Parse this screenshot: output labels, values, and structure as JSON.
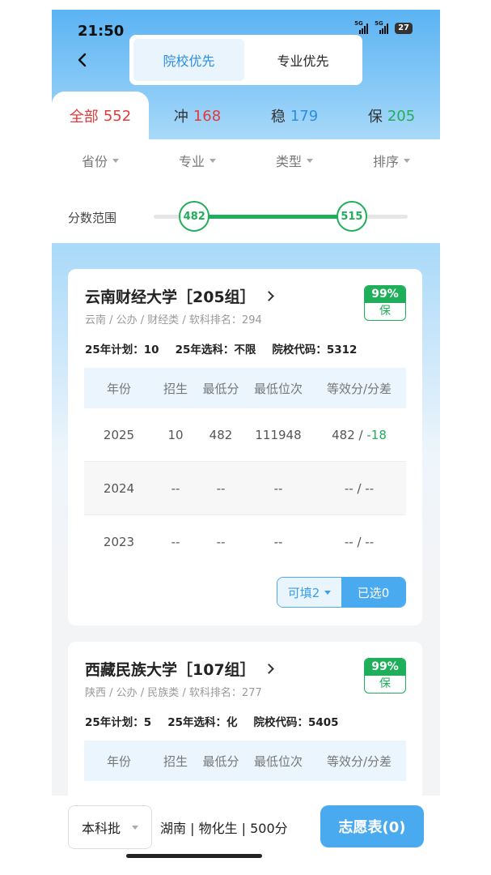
{
  "status": {
    "time": "21:50",
    "net1": "5G",
    "net2": "5G",
    "battery": "27"
  },
  "segment": {
    "options": [
      "院校优先",
      "专业优先"
    ],
    "active": 0
  },
  "tabs": [
    {
      "label": "全部",
      "count": "552",
      "color": "#e03a3a"
    },
    {
      "label": "冲",
      "count": "168",
      "color": "#e03a3a"
    },
    {
      "label": "稳",
      "count": "179",
      "color": "#2b8de3"
    },
    {
      "label": "保",
      "count": "205",
      "color": "#1fae5a"
    }
  ],
  "filters": [
    "省份",
    "专业",
    "类型",
    "排序"
  ],
  "score_range": {
    "label": "分数范围",
    "min": "482",
    "max": "515",
    "low_fraction": 0.16,
    "high_fraction": 0.78
  },
  "table_headers": [
    "年份",
    "招生",
    "最低分",
    "最低位次",
    "等效分/分差"
  ],
  "cards": [
    {
      "name": "云南财经大学［205组］",
      "sub": "云南 / 公办 / 财经类 / 软科排名：294",
      "badge_pct": "99%",
      "badge_label": "保",
      "info": [
        "25年计划：10",
        "25年选科：不限",
        "院校代码：5312"
      ],
      "rows": [
        {
          "year": "2025",
          "plan": "10",
          "min": "482",
          "rank": "111948",
          "eq": "482",
          "diff": "-18"
        },
        {
          "year": "2024",
          "plan": "--",
          "min": "--",
          "rank": "--",
          "eq": "--",
          "diff": "--"
        },
        {
          "year": "2023",
          "plan": "--",
          "min": "--",
          "rank": "--",
          "eq": "--",
          "diff": "--"
        }
      ],
      "fill_label": "可填2",
      "selected_label": "已选0"
    },
    {
      "name": "西藏民族大学［107组］",
      "sub": "陕西 / 公办 / 民族类 / 软科排名：277",
      "badge_pct": "99%",
      "badge_label": "保",
      "info": [
        "25年计划：5",
        "25年选科：化",
        "院校代码：5405"
      ],
      "rows": []
    }
  ],
  "bottom": {
    "batch": "本科批",
    "province_info": "湖南 | 物化生 | 500分",
    "apply_label": "志愿表(0)"
  }
}
